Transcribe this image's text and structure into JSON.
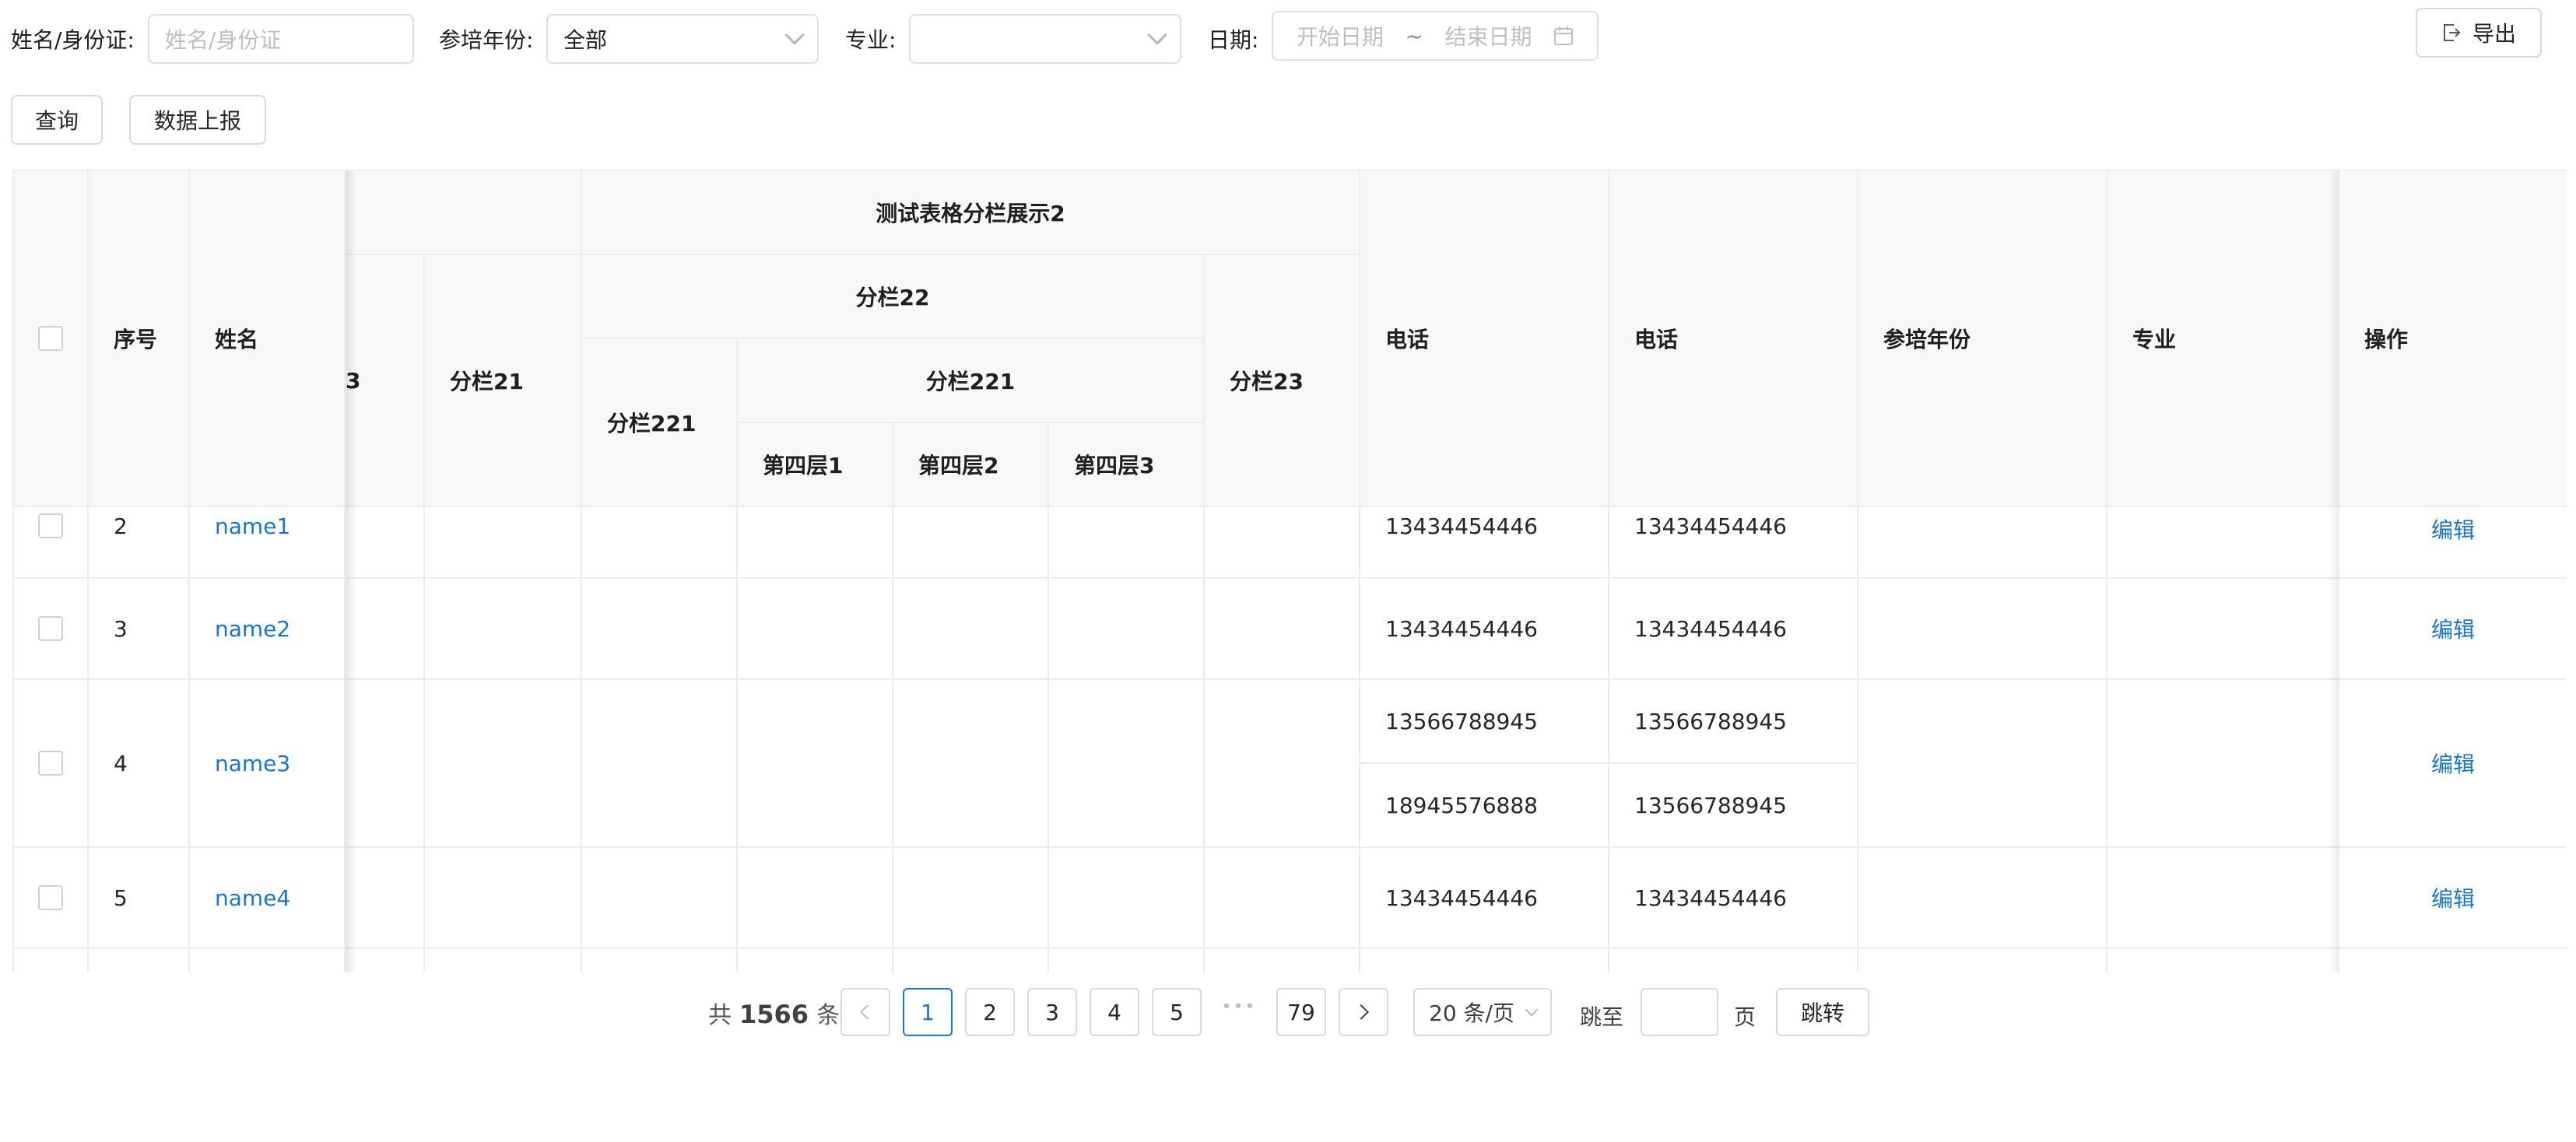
{
  "filters": {
    "name_label": "姓名/身份证:",
    "name_placeholder": "姓名/身份证",
    "year_label": "参培年份:",
    "year_value": "全部",
    "major_label": "专业:",
    "major_value": "",
    "date_label": "日期:",
    "date_start_placeholder": "开始日期",
    "date_sep": "~",
    "date_end_placeholder": "结束日期",
    "export_label": "导出",
    "query_label": "查询",
    "report_label": "数据上报"
  },
  "table": {
    "headers": {
      "seq": "序号",
      "name": "姓名",
      "group1_partial": "",
      "col_partial": "3",
      "col21": "分栏21",
      "group2": "测试表格分栏展示2",
      "col22": "分栏22",
      "col221a": "分栏221",
      "col221b": "分栏221",
      "level4_1": "第四层1",
      "level4_2": "第四层2",
      "level4_3": "第四层3",
      "col23": "分栏23",
      "phone1": "电话",
      "phone2": "电话",
      "year": "参培年份",
      "major": "专业",
      "action": "操作"
    },
    "rows": [
      {
        "seq": "2",
        "name": "name1",
        "phone1": "13434454446",
        "phone2": "13434454446",
        "action": "编辑"
      },
      {
        "seq": "3",
        "name": "name2",
        "phone1": "13434454446",
        "phone2": "13434454446",
        "action": "编辑"
      },
      {
        "seq": "4",
        "name": "name3",
        "phone1a": "13566788945",
        "phone2a": "13566788945",
        "phone1b": "18945576888",
        "phone2b": "13566788945",
        "action": "编辑"
      },
      {
        "seq": "5",
        "name": "name4",
        "phone1": "13434454446",
        "phone2": "13434454446",
        "action": "编辑"
      }
    ]
  },
  "pagination": {
    "total_prefix": "共",
    "total": "1566",
    "total_suffix": "条",
    "pages": [
      "1",
      "2",
      "3",
      "4",
      "5"
    ],
    "ellipsis": "•••",
    "last_page": "79",
    "page_size": "20 条/页",
    "jump_label": "跳至",
    "jump_suffix": "页",
    "jump_button": "跳转"
  }
}
